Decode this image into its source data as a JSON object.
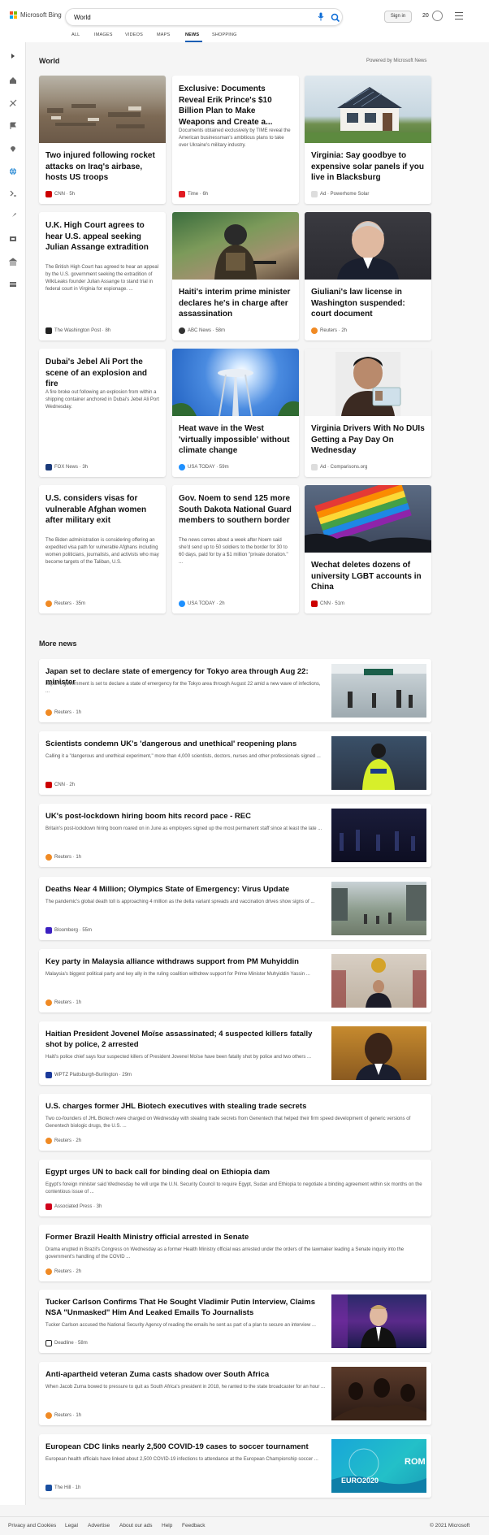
{
  "header": {
    "logo_text": "Microsoft Bing",
    "search_value": "World",
    "signin_label": "Sign in",
    "rewards_points": "20"
  },
  "tabs": [
    {
      "label": "ALL"
    },
    {
      "label": "IMAGES"
    },
    {
      "label": "VIDEOS"
    },
    {
      "label": "MAPS"
    },
    {
      "label": "NEWS",
      "active": true
    },
    {
      "label": "SHOPPING"
    }
  ],
  "sidebar": [
    "chevron-right-icon",
    "home-icon",
    "sports-icon",
    "flag-icon",
    "pin-icon",
    "globe-icon",
    "money-icon",
    "rocket-icon",
    "film-icon",
    "building-icon",
    "card-icon"
  ],
  "world": {
    "title": "World",
    "powered": "Powered by Microsoft News"
  },
  "cards": [
    {
      "title": "Two injured following rocket attacks on Iraq's airbase, hosts US troops",
      "summary": "",
      "source": "CNN · 5h",
      "logo_color": "#cc0000",
      "image": "desert base"
    },
    {
      "title": "Exclusive: Documents Reveal Erik Prince's $10 Billion Plan to Make Weapons and Create a...",
      "summary": "Documents obtained exclusively by TIME reveal the American businessman's ambitious plans to take over Ukraine's military industry.",
      "source": "Time · 6h",
      "logo_color": "#e11b22",
      "image": ""
    },
    {
      "title": "Virginia: Say goodbye to expensive solar panels if you live in Blacksburg",
      "summary": "",
      "source": "Ad · Powerhome Solar",
      "logo_color": "#aaaaaa",
      "image": "house with solar panels"
    },
    {
      "title": "U.K. High Court agrees to hear U.S. appeal seeking Julian Assange extradition",
      "summary": "The British High Court has agreed to hear an appeal by the U.S. government seeking the extradition of WikiLeaks founder Julian Assange to stand trial in federal court in Virginia for espionage. ...",
      "source": "The Washington Post · 8h",
      "logo_color": "#222222",
      "image": ""
    },
    {
      "title": "Haiti's interim prime minister declares he's in charge after assassination",
      "summary": "",
      "source": "ABC News · 58m",
      "logo_color": "#333333",
      "image": "armed officer"
    },
    {
      "title": "Giuliani's law license in Washington suspended: court document",
      "summary": "",
      "source": "Reuters · 2h",
      "logo_color": "#f08a24",
      "image": "portrait"
    },
    {
      "title": "Dubai's Jebel Ali Port the scene of an explosion and fire",
      "summary": "A fire broke out following an explosion from within a shipping container anchored in Dubai's Jebel Ali Port Wednesday.",
      "source": "FOX News · 3h",
      "logo_color": "#1a3a7a",
      "image": ""
    },
    {
      "title": "Heat wave in the West 'virtually impossible' without climate change",
      "summary": "",
      "source": "USA TODAY · 59m",
      "logo_color": "#1e90ff",
      "image": "space needle"
    },
    {
      "title": "Virginia Drivers With No DUIs Getting a Pay Day On Wednesday",
      "summary": "",
      "source": "Ad · Comparisons.org",
      "logo_color": "#aaaaaa",
      "image": "man with license"
    },
    {
      "title": "U.S. considers visas for vulnerable Afghan women after military exit",
      "summary": "The Biden administration is considering offering an expedited visa path for vulnerable Afghans including women politicians, journalists, and activists who may become targets of the Taliban, U.S.",
      "source": "Reuters · 35m",
      "logo_color": "#f08a24",
      "image": ""
    },
    {
      "title": "Gov. Noem to send 125 more South Dakota National Guard members to southern border",
      "summary": "The news comes about a week after Noem said she'd send up to 50 soldiers to the border for 30 to 60 days, paid for by a $1 million \"private donation.\" ...",
      "source": "USA TODAY · 2h",
      "logo_color": "#1e90ff",
      "image": ""
    },
    {
      "title": "Wechat deletes dozens of university LGBT accounts in China",
      "summary": "",
      "source": "CNN · 51m",
      "logo_color": "#cc0000",
      "image": "rainbow flag"
    }
  ],
  "more_news": {
    "title": "More news",
    "items": [
      {
        "title": "Japan set to declare state of emergency for Tokyo area through Aug 22: minister",
        "summary": "Japan's government is set to declare a state of emergency for the Tokyo area through August 22 amid a new wave of infections, ...",
        "source": "Reuters · 1h",
        "logo_color": "#f08a24",
        "image": true
      },
      {
        "title": "Scientists condemn UK's 'dangerous and unethical' reopening plans",
        "summary": "Calling it a \"dangerous and unethical experiment,\" more than 4,000 scientists, doctors, nurses and other professionals signed ...",
        "source": "CNN · 2h",
        "logo_color": "#cc0000",
        "image": true
      },
      {
        "title": "UK's post-lockdown hiring boom hits record pace - REC",
        "summary": "Britain's post-lockdown hiring boom roared on in June as employers signed up the most permanent staff since at least the late ...",
        "source": "Reuters · 1h",
        "logo_color": "#f08a24",
        "image": true
      },
      {
        "title": "Deaths Near 4 Million; Olympics State of Emergency: Virus Update",
        "summary": "The pandemic's global death toll is approaching 4 million as the delta variant spreads and vaccination drives show signs of ...",
        "source": "Bloomberg · 55m",
        "logo_color": "#3b1fc1",
        "image": true
      },
      {
        "title": "Key party in Malaysia alliance withdraws support from PM Muhyiddin",
        "summary": "Malaysia's biggest political party and key ally in the ruling coalition withdrew support for Prime Minister Muhyiddin Yassin ...",
        "source": "Reuters · 1h",
        "logo_color": "#f08a24",
        "image": true
      },
      {
        "title": "Haitian President Jovenel Moïse assassinated; 4 suspected killers fatally shot by police, 2 arrested",
        "summary": "Haiti's police chief says four suspected killers of President Jovenel Moïse have been fatally shot by police and two others ...",
        "source": "WPTZ Plattsburgh-Burlington · 29m",
        "logo_color": "#1a3a9a",
        "image": true
      },
      {
        "title": "U.S. charges former JHL Biotech executives with stealing trade secrets",
        "summary": "Two co-founders of JHL Biotech were charged on Wednesday with stealing trade secrets from Genentech that helped their firm speed development of generic versions of Genentech biologic drugs, the U.S. ...",
        "source": "Reuters · 2h",
        "logo_color": "#f08a24",
        "image": false
      },
      {
        "title": "Egypt urges UN to back call for binding deal on Ethiopia dam",
        "summary": "Egypt's foreign minister said Wednesday he will urge the U.N. Security Council to require Egypt, Sudan and Ethiopia to negotiate a binding agreement within six months on the contentious issue of ...",
        "source": "Associated Press · 3h",
        "logo_color": "#d0021b",
        "image": false
      },
      {
        "title": "Former Brazil Health Ministry official arrested in Senate",
        "summary": "Drama erupted in Brazil's Congress on Wednesday as a former Health Ministry official was arrested under the orders of the lawmaker leading a Senate inquiry into the government's handling of the COVID ...",
        "source": "Reuters · 2h",
        "logo_color": "#f08a24",
        "image": false
      },
      {
        "title": "Tucker Carlson Confirms That He Sought Vladimir Putin Interview, Claims NSA \"Unmasked\" Him And Leaked Emails To Journalists",
        "summary": "Tucker Carlson accused the National Security Agency of reading the emails he sent as part of a plan to secure an interview ...",
        "source": "Deadline · 58m",
        "logo_color": "#222222",
        "image": true
      },
      {
        "title": "Anti-apartheid veteran Zuma casts shadow over South Africa",
        "summary": "When Jacob Zuma bowed to pressure to quit as South Africa's president in 2018, he ranted to the state broadcaster for an hour ...",
        "source": "Reuters · 1h",
        "logo_color": "#f08a24",
        "image": true
      },
      {
        "title": "European CDC links nearly 2,500 COVID-19 cases to soccer tournament",
        "summary": "European health officials have linked about 2,500 COVID-19 infections to attendance at the European Championship soccer ...",
        "source": "The Hill · 1h",
        "logo_color": "#1a4fa0",
        "image": true
      }
    ]
  },
  "footer": {
    "links": [
      "Privacy and Cookies",
      "Legal",
      "Advertise",
      "About our ads",
      "Help",
      "Feedback"
    ],
    "copyright": "© 2021 Microsoft"
  },
  "image_texts": {
    "euro": "EURO2020",
    "rom": "ROM"
  }
}
